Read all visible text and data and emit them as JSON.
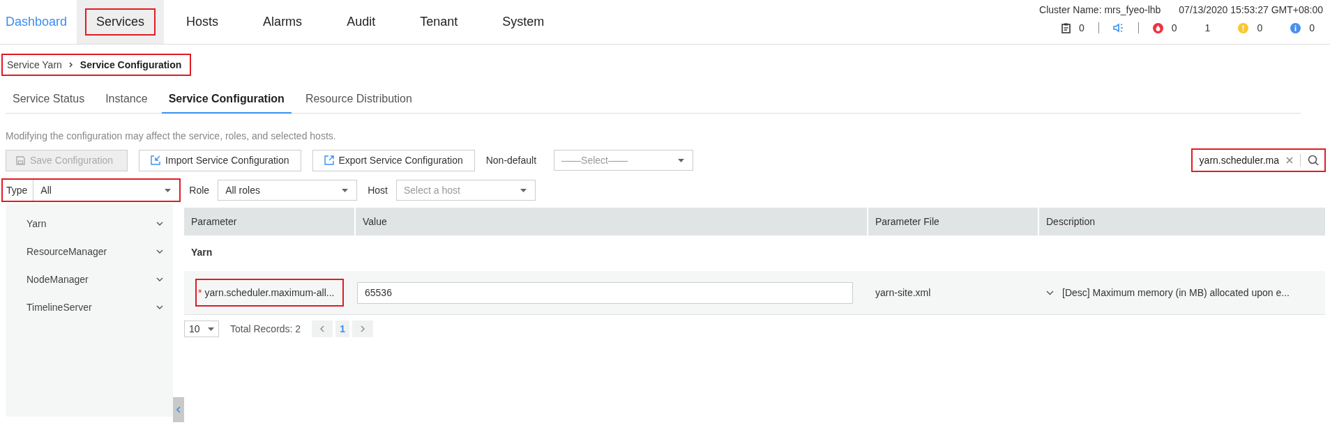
{
  "nav": {
    "items": [
      {
        "label": "Dashboard",
        "kind": "link",
        "selected": false,
        "highlighted": false
      },
      {
        "label": "Services",
        "kind": "tab",
        "selected": true,
        "highlighted": true
      },
      {
        "label": "Hosts",
        "kind": "tab",
        "selected": false,
        "highlighted": false
      },
      {
        "label": "Alarms",
        "kind": "tab",
        "selected": false,
        "highlighted": false
      },
      {
        "label": "Audit",
        "kind": "tab",
        "selected": false,
        "highlighted": false
      },
      {
        "label": "Tenant",
        "kind": "tab",
        "selected": false,
        "highlighted": false
      },
      {
        "label": "System",
        "kind": "tab",
        "selected": false,
        "highlighted": false
      }
    ]
  },
  "header": {
    "cluster_name": "Cluster Name: mrs_fyeo-lhb",
    "datetime": "07/13/2020 15:53:27 GMT+08:00",
    "counters": [
      {
        "kind": "tasks",
        "count": "0"
      },
      {
        "kind": "sound"
      },
      {
        "kind": "critical",
        "count": "0",
        "color": "#f0313f"
      },
      {
        "kind": "major",
        "count": "1"
      },
      {
        "kind": "minor",
        "count": "0",
        "color": "#fcc62d"
      },
      {
        "kind": "info",
        "count": "0",
        "color": "#4a8ff0"
      }
    ]
  },
  "breadcrumb": {
    "items": [
      "Service Yarn",
      "Service Configuration"
    ],
    "highlighted": true
  },
  "tabs": [
    {
      "label": "Service Status",
      "selected": false
    },
    {
      "label": "Instance",
      "selected": false
    },
    {
      "label": "Service Configuration",
      "selected": true
    },
    {
      "label": "Resource Distribution",
      "selected": false
    }
  ],
  "hint": "Modifying the configuration may affect the service, roles, and selected hosts.",
  "toolbar": {
    "buttons": [
      {
        "kind": "save",
        "label": "Save Configuration",
        "disabled": true
      },
      {
        "kind": "import",
        "label": "Import Service Configuration",
        "disabled": false
      },
      {
        "kind": "export",
        "label": "Export Service Configuration",
        "disabled": false
      }
    ],
    "non_default": {
      "label": "Non-default",
      "placeholder": "——Select——"
    },
    "search": {
      "value": "yarn.scheduler.ma",
      "highlighted": true
    }
  },
  "filters": [
    {
      "label": "Type",
      "value": "All",
      "highlighted": true
    },
    {
      "label": "Role",
      "value": "All roles",
      "highlighted": false
    },
    {
      "label": "Host",
      "placeholder": "Select a host",
      "highlighted": false
    }
  ],
  "sidebar": {
    "items": [
      "Yarn",
      "ResourceManager",
      "NodeManager",
      "TimelineServer"
    ]
  },
  "table": {
    "columns": [
      "Parameter",
      "Value",
      "Parameter File",
      "Description"
    ],
    "groups": [
      {
        "title": "Yarn",
        "rows": [
          {
            "parameter": "yarn.scheduler.maximum-all...",
            "required_mark": "*",
            "highlighted": true,
            "value": "65536",
            "file": "yarn-site.xml",
            "description": "[Desc] Maximum memory (in MB) allocated upon e..."
          }
        ]
      }
    ]
  },
  "pagination": {
    "page_size": "10",
    "total": "Total Records: 2",
    "pages": [
      {
        "label": "1",
        "selected": true
      }
    ]
  }
}
